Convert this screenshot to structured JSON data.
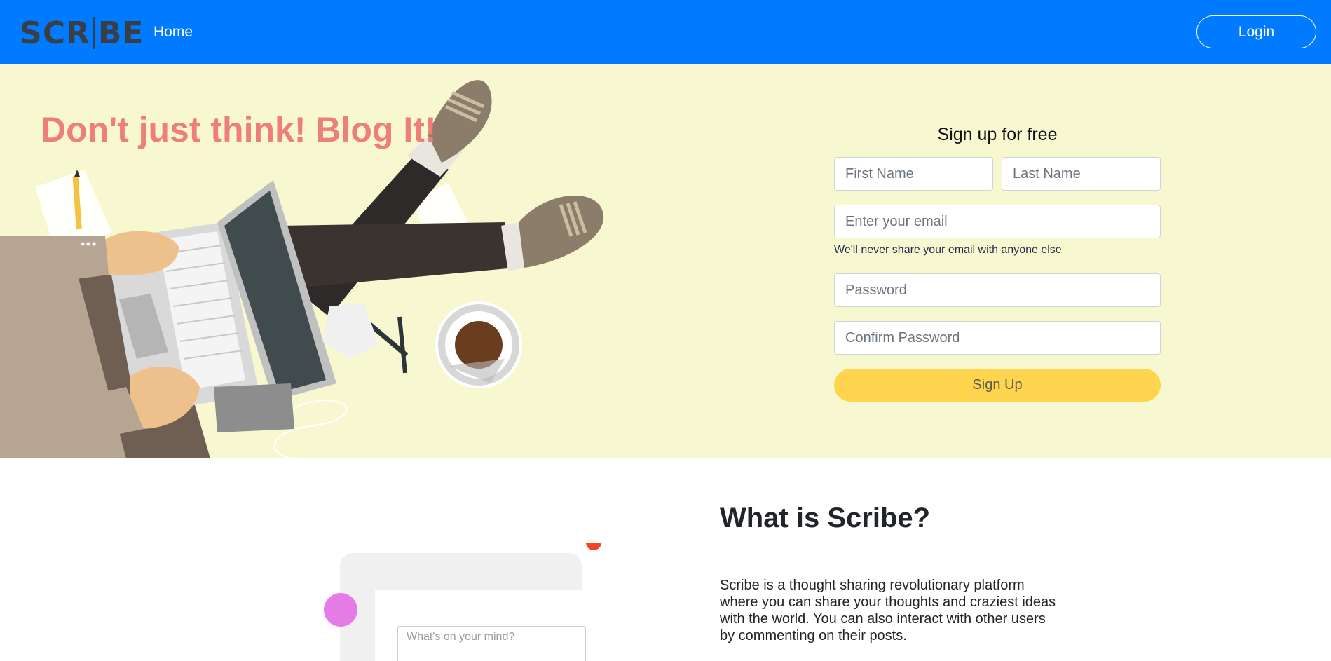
{
  "nav": {
    "logo_text": "SCR|BE",
    "home_label": "Home",
    "login_label": "Login"
  },
  "hero": {
    "headline": "Don't just think! Blog It!",
    "signup": {
      "title": "Sign up for free",
      "first_name_placeholder": "First Name",
      "last_name_placeholder": "Last Name",
      "email_placeholder": "Enter your email",
      "email_help": "We'll never share your email with anyone else",
      "password_placeholder": "Password",
      "confirm_password_placeholder": "Confirm Password",
      "submit_label": "Sign Up"
    }
  },
  "about": {
    "title": "What is Scribe?",
    "description": "Scribe is a thought sharing revolutionary platform where you can share your thoughts and craziest ideas with the world. You can also interact with other users by commenting on their posts.",
    "post_placeholder": "What's on your mind?"
  },
  "colors": {
    "navbar": "#007bff",
    "hero_background": "#f8f8d0",
    "headline": "#ee7f78",
    "signup_button": "#ffd550"
  },
  "icons": [
    "logo-mark",
    "laptop-illustration",
    "coffee-cup-illustration",
    "pencil-illustration"
  ]
}
